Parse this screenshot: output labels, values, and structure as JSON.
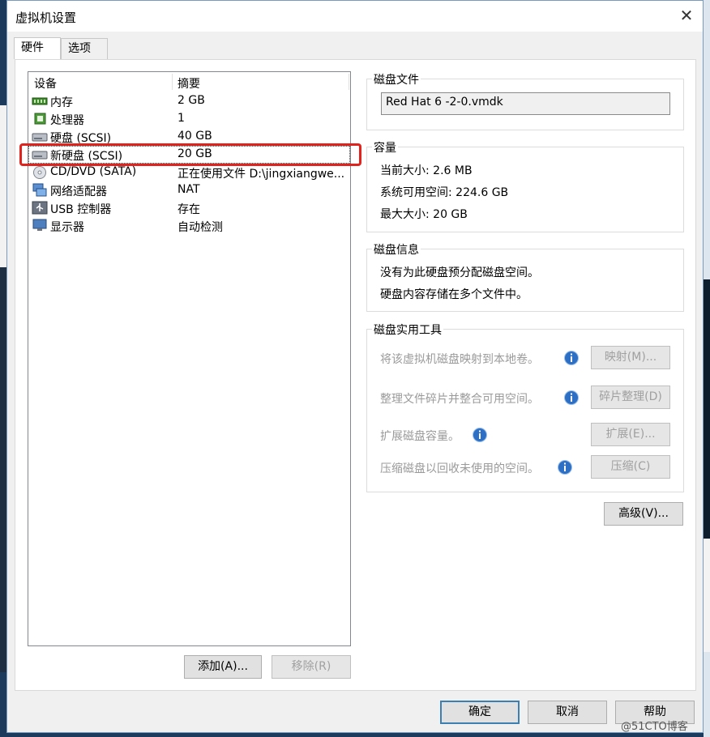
{
  "window": {
    "title": "虚拟机设置",
    "close_glyph": "✕"
  },
  "tabs": [
    {
      "label": "硬件"
    },
    {
      "label": "选项"
    }
  ],
  "devices": {
    "header": {
      "device": "设备",
      "summary": "摘要"
    },
    "rows": [
      {
        "name": "内存",
        "summary": "2 GB",
        "icon": "memory-icon"
      },
      {
        "name": "处理器",
        "summary": "1",
        "icon": "processor-icon"
      },
      {
        "name": "硬盘 (SCSI)",
        "summary": "40 GB",
        "icon": "hard-disk-icon"
      },
      {
        "name": "新硬盘 (SCSI)",
        "summary": "20 GB",
        "icon": "hard-disk-icon"
      },
      {
        "name": "CD/DVD (SATA)",
        "summary": "正在使用文件 D:\\jingxiangwe...",
        "icon": "cd-dvd-icon"
      },
      {
        "name": "网络适配器",
        "summary": "NAT",
        "icon": "network-adapter-icon"
      },
      {
        "name": "USB 控制器",
        "summary": "存在",
        "icon": "usb-icon"
      },
      {
        "name": "显示器",
        "summary": "自动检测",
        "icon": "monitor-icon"
      }
    ]
  },
  "left_buttons": {
    "add": "添加(A)...",
    "remove": "移除(R)"
  },
  "disk_file": {
    "title": "磁盘文件",
    "value": "Red Hat 6 -2-0.vmdk"
  },
  "capacity": {
    "title": "容量",
    "current": "当前大小: 2.6 MB",
    "available": "系统可用空间: 224.6 GB",
    "max": "最大大小: 20 GB"
  },
  "disk_info": {
    "title": "磁盘信息",
    "line1": "没有为此硬盘预分配磁盘空间。",
    "line2": "硬盘内容存储在多个文件中。"
  },
  "disk_tools": {
    "title": "磁盘实用工具",
    "map_text": "将该虚拟机磁盘映射到本地卷。",
    "map_btn": "映射(M)...",
    "defrag_text": "整理文件碎片并整合可用空间。",
    "defrag_btn": "碎片整理(D)",
    "expand_text": "扩展磁盘容量。",
    "expand_btn": "扩展(E)...",
    "compact_text": "压缩磁盘以回收未使用的空间。",
    "compact_btn": "压缩(C)"
  },
  "advanced_btn": "高级(V)...",
  "footer": {
    "ok": "确定",
    "cancel": "取消",
    "help": "帮助"
  },
  "watermark": "@51CTO博客"
}
